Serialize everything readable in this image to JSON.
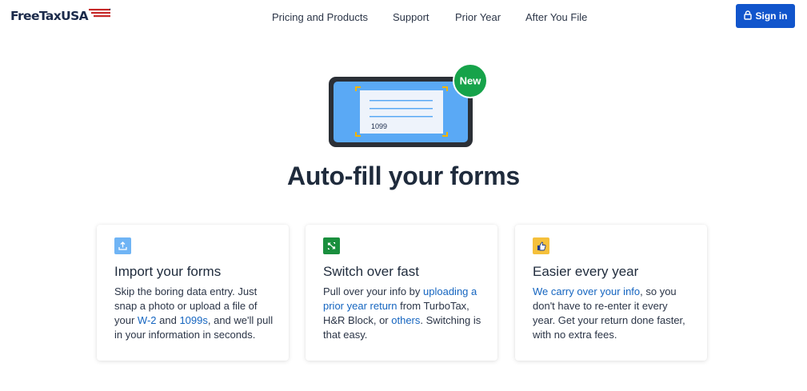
{
  "header": {
    "logo_text": "FreeTaxUSA",
    "nav": [
      {
        "label": "Pricing and Products"
      },
      {
        "label": "Support"
      },
      {
        "label": "Prior Year"
      },
      {
        "label": "After You File"
      }
    ],
    "signin_label": "Sign in"
  },
  "hero": {
    "badge": "New",
    "form_label": "1099",
    "headline": "Auto-fill your forms"
  },
  "cards": [
    {
      "icon": "upload-icon",
      "title": "Import your forms",
      "body": {
        "t1": "Skip the boring data entry. Just snap a photo or upload a file of your ",
        "link1": "W-2",
        "t2": " and ",
        "link2": "1099s",
        "t3": ", and we'll pull in your information in seconds."
      }
    },
    {
      "icon": "switch-arrows-icon",
      "title": "Switch over fast",
      "body": {
        "t1": "Pull over your info by ",
        "link1": "uploading a prior year return",
        "t2": " from TurboTax, H&R Block, or ",
        "link2": "others",
        "t3": ". Switching is that easy."
      }
    },
    {
      "icon": "thumbs-up-icon",
      "title": "Easier every year",
      "body": {
        "link1": "We carry over your info",
        "t1": ", so you don't have to re-enter it every year. Get your return done faster, with no extra fees."
      }
    }
  ],
  "colors": {
    "primary": "#1155cc",
    "badge_green": "#16a34a",
    "phone_screen": "#5aa9f5",
    "link": "#1565c0"
  }
}
